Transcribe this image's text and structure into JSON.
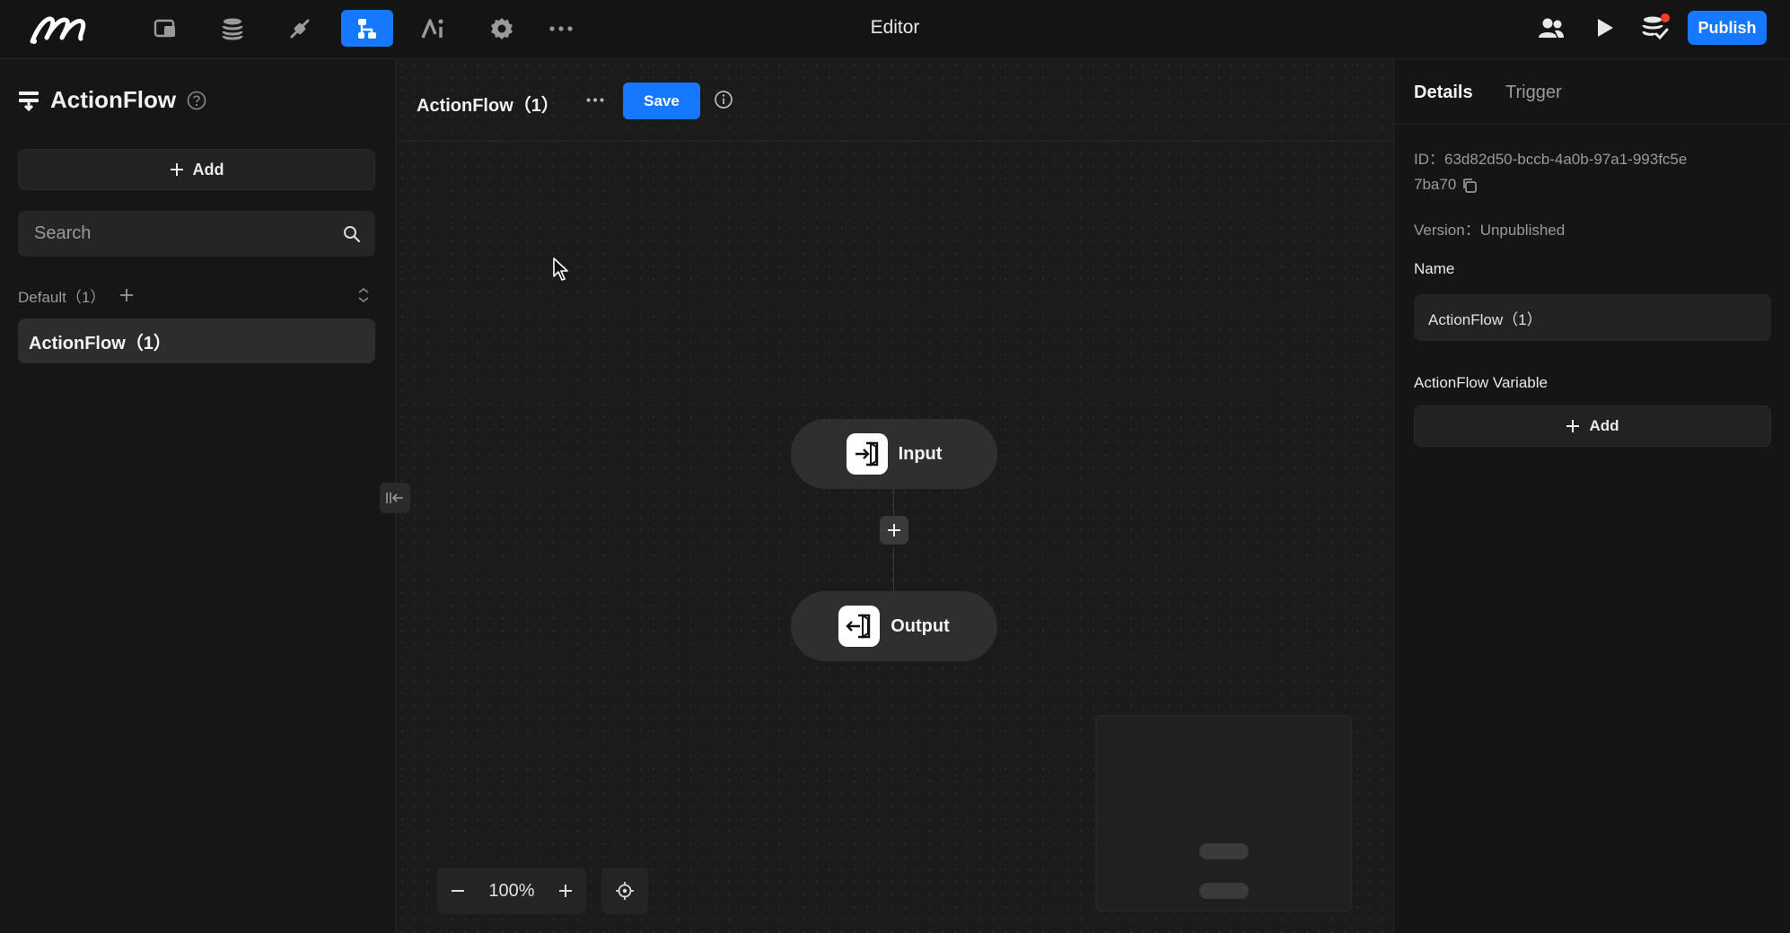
{
  "topbar": {
    "title": "Editor",
    "publish_label": "Publish",
    "nav_icons": [
      "pages-icon",
      "database-icon",
      "plugin-icon",
      "actionflow-icon",
      "ai-icon",
      "settings-icon",
      "more-icon"
    ],
    "active_nav": "actionflow-icon"
  },
  "sidebar": {
    "title": "ActionFlow",
    "add_label": "Add",
    "search_placeholder": "Search",
    "group_label": "Default（1）",
    "items": [
      {
        "label": "ActionFlow（1）"
      }
    ]
  },
  "canvas": {
    "flow_title": "ActionFlow（1）",
    "save_label": "Save",
    "nodes": [
      {
        "label": "Input"
      },
      {
        "label": "Output"
      }
    ],
    "zoom": "100%"
  },
  "details": {
    "tabs": [
      {
        "label": "Details"
      },
      {
        "label": "Trigger"
      }
    ],
    "id_text": "ID：63d82d50-bccb-4a0b-97a1-993fc5e7ba70",
    "version_text": "Version：Unpublished",
    "name_label": "Name",
    "name_value": "ActionFlow（1）",
    "variable_label": "ActionFlow Variable",
    "add_label": "Add"
  },
  "colors": {
    "accent": "#1677ff",
    "background": "#151515",
    "canvas": "#1b1b1b",
    "node": "#2f2f2f",
    "notification": "#ff3b30"
  }
}
